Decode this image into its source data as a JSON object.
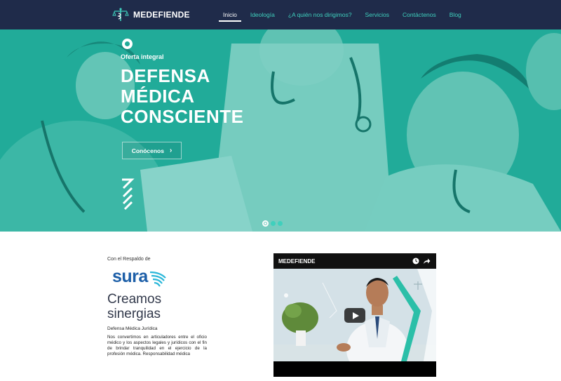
{
  "nav": {
    "brand": "MEDEFIENDE",
    "items": [
      {
        "label": "Inicio",
        "active": true
      },
      {
        "label": "Ideología",
        "active": false
      },
      {
        "label": "¿A quién nos dirigimos?",
        "active": false
      },
      {
        "label": "Servicios",
        "active": false
      },
      {
        "label": "Contáctenos",
        "active": false
      },
      {
        "label": "Blog",
        "active": false
      }
    ]
  },
  "hero": {
    "kicker": "Oferta integral",
    "title_lines": [
      "DEFENSA",
      "MÉDICA",
      "CONSCIENTE"
    ],
    "button_label": "Conócenos",
    "button_chevron": "›",
    "slides": 3,
    "active_slide": 1
  },
  "content": {
    "backed_by": "Con el Respaldo de",
    "partner": "sura",
    "title_lines": [
      "Creamos",
      "sinergias"
    ],
    "subheading": "Defensa Médica Jurídica",
    "paragraph": "Nos convertimos en articuladores entre el oficio médico y los aspectos legales y jurídicos con el fin de brindar tranquilidad en el ejercicio de la profesión médica. Responsabilidad médica"
  },
  "video": {
    "title": "MEDEFIENDE",
    "icons": [
      "clock-icon",
      "share-icon",
      "play-icon"
    ]
  },
  "colors": {
    "nav_bg": "#1f2b4a",
    "accent": "#3fd0bd",
    "hero_tint": "#12a896",
    "sura_blue": "#1d5fa8"
  }
}
